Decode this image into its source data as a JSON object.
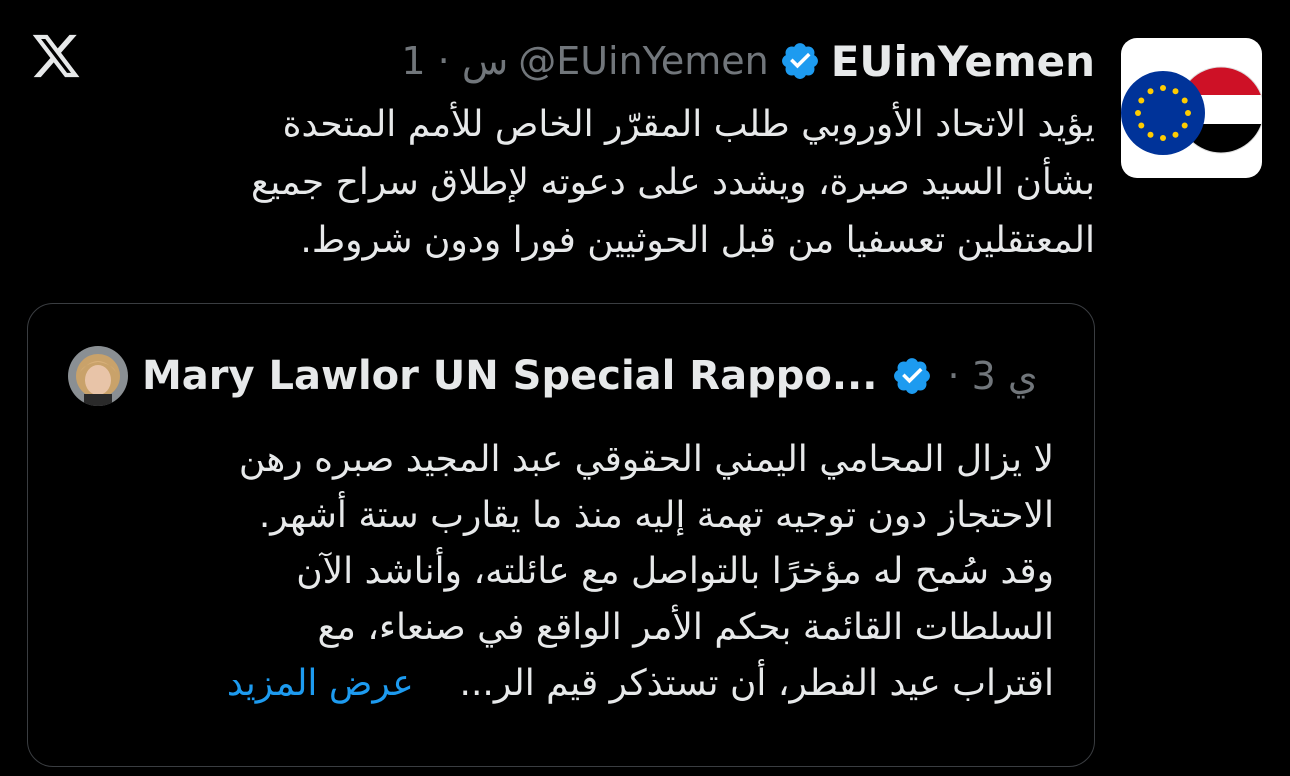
{
  "tweet": {
    "display_name": "EUinYemen",
    "handle": "@EUinYemen",
    "time": "1 · س",
    "text_lines": [
      "يؤيد الاتحاد الأوروبي طلب المقرّر الخاص للأمم المتحدة",
      "بشأن السيد صبرة، ويشدد على دعوته لإطلاق سراح جميع",
      "المعتقلين تعسفيا من قبل الحوثيين فورا ودون شروط."
    ],
    "verified": true
  },
  "quote": {
    "display_name": "Mary Lawlor UN Special Rappo...",
    "time": "· 3 ي",
    "verified": true,
    "text_lines": [
      "لا يزال المحامي اليمني الحقوقي عبد المجيد صبره رهن",
      "الاحتجاز دون توجيه تهمة إليه منذ ما يقارب ستة أشهر.",
      "وقد سُمح له مؤخرًا بالتواصل مع عائلته، وأناشد الآن",
      "السلطات القائمة بحكم الأمر الواقع في صنعاء، مع",
      "اقتراب عيد الفطر، أن تستذكر قيم الر..."
    ],
    "show_more": "عرض المزيد"
  },
  "icons": {
    "app_logo": "x-logo-icon",
    "verified": "verified-badge-icon",
    "avatar": "eu-yemen-flags-avatar"
  },
  "colors": {
    "background": "#000000",
    "text": "#e7e9ea",
    "muted": "#71767b",
    "link": "#1d9bf0",
    "verified": "#1d9bf0",
    "border": "#3a3d41"
  }
}
